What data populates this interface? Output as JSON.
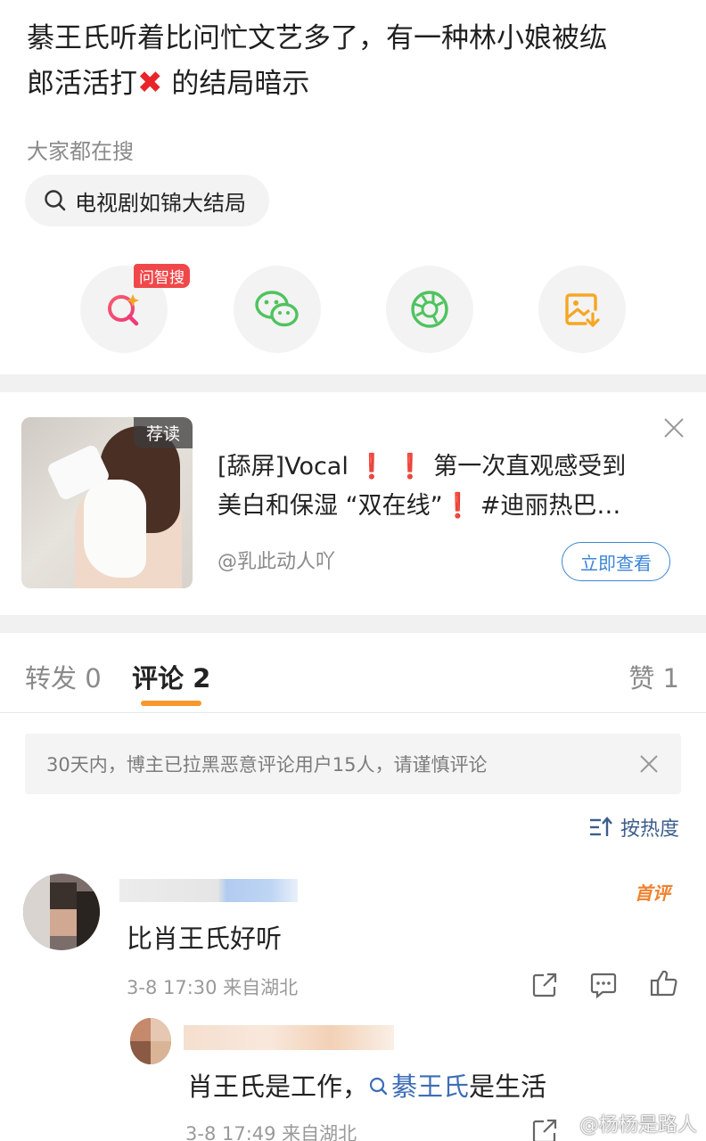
{
  "post": {
    "text_line1": "綦王氏听着比问忙文艺多了，有一种林小娘被纮",
    "text_line2_a": "郎活活打",
    "text_line2_emoji": "✖",
    "text_line2_b": " 的结局暗示"
  },
  "search": {
    "hint": "大家都在搜",
    "chip_label": "电视剧如锦大结局"
  },
  "share": {
    "badge": "问智搜",
    "icons": [
      "ai-search-icon",
      "wechat-icon",
      "moments-icon",
      "save-image-icon"
    ]
  },
  "recommend": {
    "tag": "荐读",
    "title_a": "[舔屏]Vocal",
    "title_b": "第一次直观感受到",
    "title_c": "美白和保湿 “双在线”",
    "title_d": " #迪丽热巴…",
    "author": "@乳此动人吖",
    "button": "立即查看"
  },
  "tabs": {
    "repost": "转发 0",
    "comments": "评论 2",
    "likes": "赞 1"
  },
  "notice": {
    "text": "30天内，博主已拉黑恶意评论用户15人，请谨慎评论"
  },
  "sort": {
    "label": "按热度"
  },
  "comment": {
    "badge": "首评",
    "body": "比肖王氏好听",
    "meta": "3-8 17:30  来自湖北"
  },
  "reply": {
    "body_a": "肖王氏是工作，",
    "link": "綦王氏",
    "body_b": "是生活",
    "meta": "3-8 17:49  来自湖北"
  },
  "watermark": "@杨杨是路人",
  "colors": {
    "accent_orange": "#f7982a",
    "link_blue": "#3d6db6",
    "alert_red": "#e8262a",
    "wechat_green": "#4fc35e",
    "save_orange": "#f5a623"
  }
}
